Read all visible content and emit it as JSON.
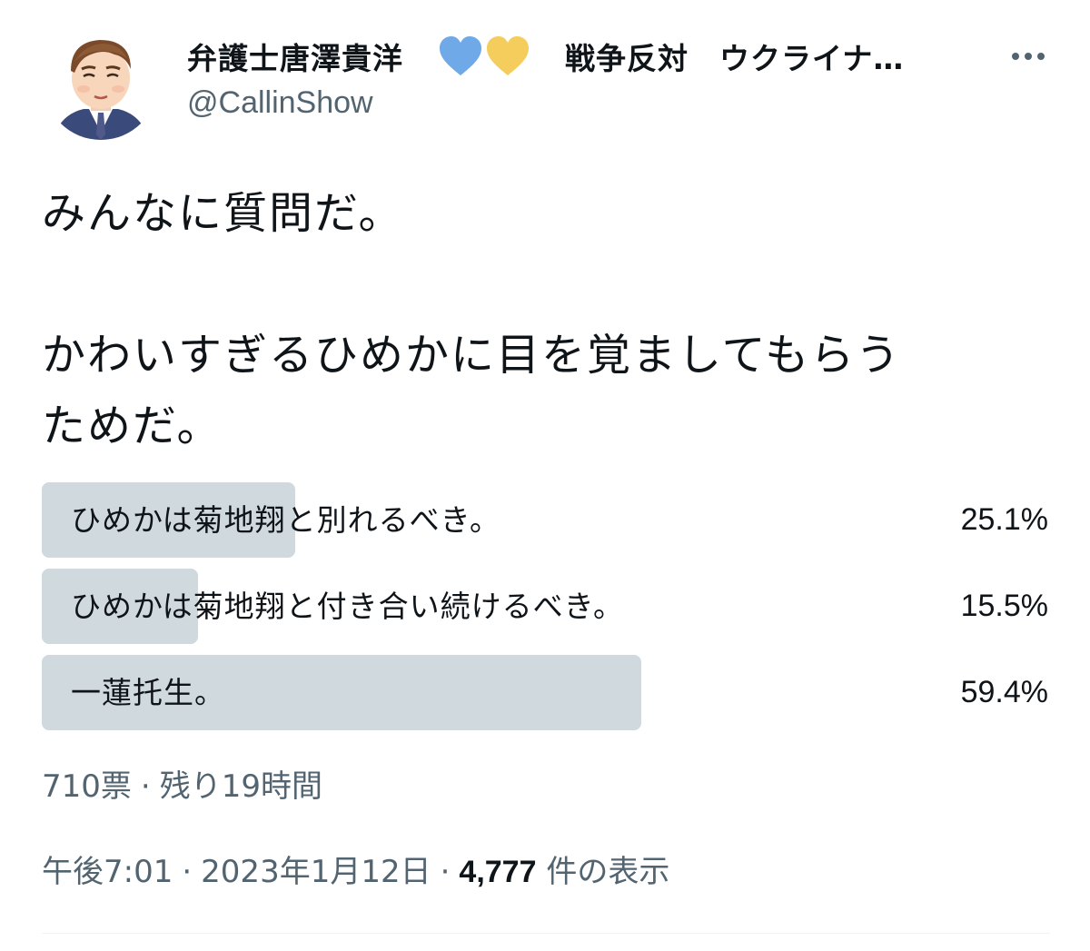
{
  "author": {
    "display_name": "弁護士唐澤貴洋",
    "name_suffix": "戦争反対　ウクライナ…",
    "handle": "@CallinShow"
  },
  "hearts": {
    "blue": "#70a9e8",
    "yellow": "#f4cd5c"
  },
  "tweet": {
    "text": "みんなに質問だ。\n\nかわいすぎるひめかに目を覚ましてもらう\nためだ。"
  },
  "poll": {
    "options": [
      {
        "label": "ひめかは菊地翔と別れるべき。",
        "percent_text": "25.1%",
        "percent": 25.1
      },
      {
        "label": "ひめかは菊地翔と付き合い続けるべき。",
        "percent_text": "15.5%",
        "percent": 15.5
      },
      {
        "label": "一蓮托生。",
        "percent_text": "59.4%",
        "percent": 59.4
      }
    ],
    "votes": "710票",
    "separator": "·",
    "remaining": "残り19時間"
  },
  "meta": {
    "time": "午後7:01",
    "separator": "·",
    "date": "2023年1月12日",
    "views_count": "4,777",
    "views_label": "件の表示"
  },
  "colors": {
    "bar": "#cfd9de",
    "secondary_text": "#536471",
    "primary_text": "#0f1419"
  }
}
